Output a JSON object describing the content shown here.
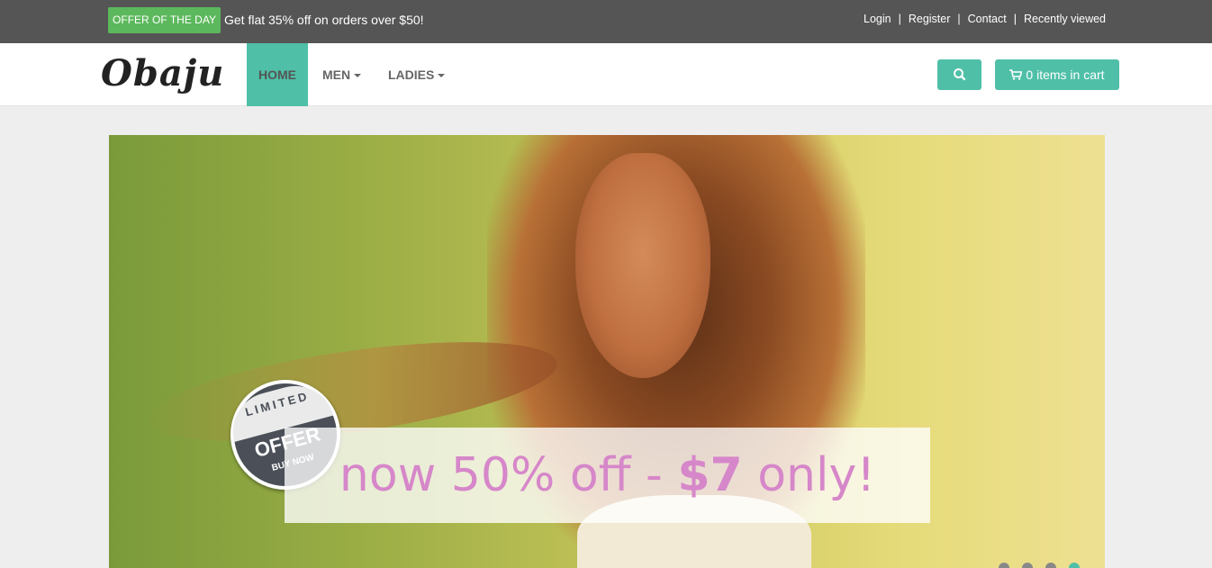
{
  "topbar": {
    "badge": "OFFER OF THE DAY",
    "offer_text": "Get flat 35% off on orders over $50!",
    "links": [
      "Login",
      "Register",
      "Contact",
      "Recently viewed"
    ]
  },
  "navbar": {
    "logo": "Obaju",
    "items": [
      "HOME",
      "MEN",
      "LADIES"
    ],
    "cart_label": "0 items in cart",
    "icons": {
      "search": "search-icon",
      "cart": "shopping-cart-icon"
    }
  },
  "hero": {
    "sticker": {
      "top": "LIMITED",
      "middle": "OFFER",
      "bottom": "BUY NOW"
    },
    "promo_prefix": "now 50% off - ",
    "promo_price": "$7",
    "promo_suffix": " only!",
    "slides": 4,
    "active_slide": 4
  },
  "colors": {
    "accent": "#4fbfa8",
    "badge": "#5cb85c",
    "promo_text": "#d687c9",
    "topbar": "#555555"
  }
}
